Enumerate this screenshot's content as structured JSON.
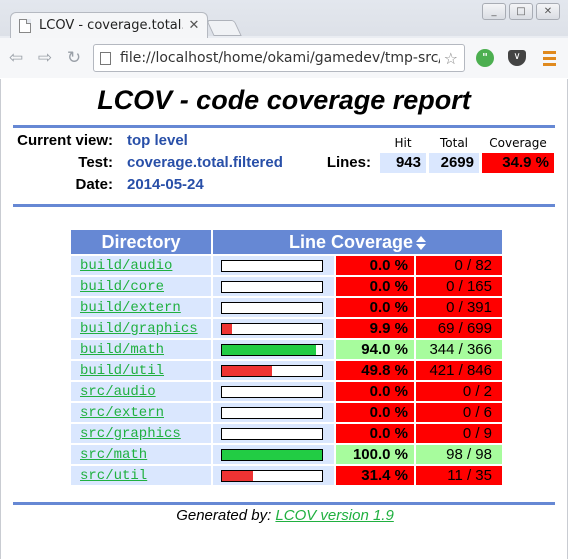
{
  "browser": {
    "tab_title": "LCOV - coverage.total.filtered",
    "url": "file://localhost/home/okami/gamedev/tmp-src/index.html",
    "window_buttons": [
      "_",
      "□",
      "✕"
    ]
  },
  "report": {
    "title": "LCOV - code coverage report",
    "labels": {
      "current_view": "Current view:",
      "test": "Test:",
      "date": "Date:",
      "lines": "Lines:"
    },
    "values": {
      "current_view": "top level",
      "test": "coverage.total.filtered",
      "date": "2014-05-24"
    },
    "summary_headers": {
      "hit": "Hit",
      "total": "Total",
      "coverage": "Coverage"
    },
    "summary": {
      "hit": "943",
      "total": "2699",
      "coverage": "34.9 %"
    },
    "table_headers": {
      "directory": "Directory",
      "line_coverage": "Line Coverage"
    },
    "rows": [
      {
        "dir": "build/audio",
        "pct": "0.0 %",
        "count": "0 / 82",
        "rate": 0.0,
        "status": "low"
      },
      {
        "dir": "build/core",
        "pct": "0.0 %",
        "count": "0 / 165",
        "rate": 0.0,
        "status": "low"
      },
      {
        "dir": "build/extern",
        "pct": "0.0 %",
        "count": "0 / 391",
        "rate": 0.0,
        "status": "low"
      },
      {
        "dir": "build/graphics",
        "pct": "9.9 %",
        "count": "69 / 699",
        "rate": 9.9,
        "status": "low"
      },
      {
        "dir": "build/math",
        "pct": "94.0 %",
        "count": "344 / 366",
        "rate": 94.0,
        "status": "high"
      },
      {
        "dir": "build/util",
        "pct": "49.8 %",
        "count": "421 / 846",
        "rate": 49.8,
        "status": "low"
      },
      {
        "dir": "src/audio",
        "pct": "0.0 %",
        "count": "0 / 2",
        "rate": 0.0,
        "status": "low"
      },
      {
        "dir": "src/extern",
        "pct": "0.0 %",
        "count": "0 / 6",
        "rate": 0.0,
        "status": "low"
      },
      {
        "dir": "src/graphics",
        "pct": "0.0 %",
        "count": "0 / 9",
        "rate": 0.0,
        "status": "low"
      },
      {
        "dir": "src/math",
        "pct": "100.0 %",
        "count": "98 / 98",
        "rate": 100.0,
        "status": "high"
      },
      {
        "dir": "src/util",
        "pct": "31.4 %",
        "count": "11 / 35",
        "rate": 31.4,
        "status": "low"
      }
    ],
    "footer": {
      "prefix": "Generated by:",
      "link": "LCOV version 1.9"
    }
  },
  "colors": {
    "low_bg": "#ff0000",
    "high_bg": "#a7fc9d",
    "low_bar": "#ee3333",
    "high_bar": "#22cc44",
    "header_blue": "#6688d4",
    "cell_blue": "#dae7fe"
  }
}
